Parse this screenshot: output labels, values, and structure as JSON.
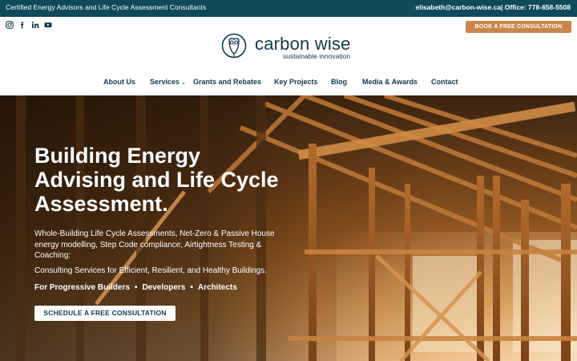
{
  "topbar": {
    "tagline": "Certified Energy Advisors and Life Cycle Assessment Consultants",
    "contact": "elisabeth@carbon-wise.ca| Office: 778-658-5508"
  },
  "header": {
    "socials": [
      "instagram-icon",
      "facebook-icon",
      "linkedin-icon",
      "youtube-icon"
    ],
    "cta_label": "BOOK A FREE CONSULTATION",
    "logo": {
      "name": "carbon wise",
      "tagline": "sustainable innovation"
    }
  },
  "nav": {
    "items": [
      {
        "label": "About Us"
      },
      {
        "label": "Services"
      },
      {
        "label": "Grants and Rebates"
      },
      {
        "label": "Key Projects"
      },
      {
        "label": "Blog"
      },
      {
        "label": "Media & Awards"
      },
      {
        "label": "Contact"
      }
    ]
  },
  "hero": {
    "title": "Building Energy Advising and Life Cycle Assessment.",
    "subtitle": "Whole-Building Life Cycle Assessments, Net-Zero & Passive House energy modelling, Step Code compliance, Airtightness Testing & Coaching:",
    "subtitle2": "Consulting Services for Efficient, Resilient, and Healthy Buildings.",
    "audience": {
      "lead": "For Progressive Builders",
      "items": [
        "Developers",
        "Architects"
      ],
      "separator": "•"
    },
    "cta_label": "SCHEDULE A FREE CONSULTATION"
  },
  "colors": {
    "topbar_bg": "#0f4a5b",
    "brand_dark": "#0f3b4c",
    "cta_orange": "#c9854b"
  }
}
